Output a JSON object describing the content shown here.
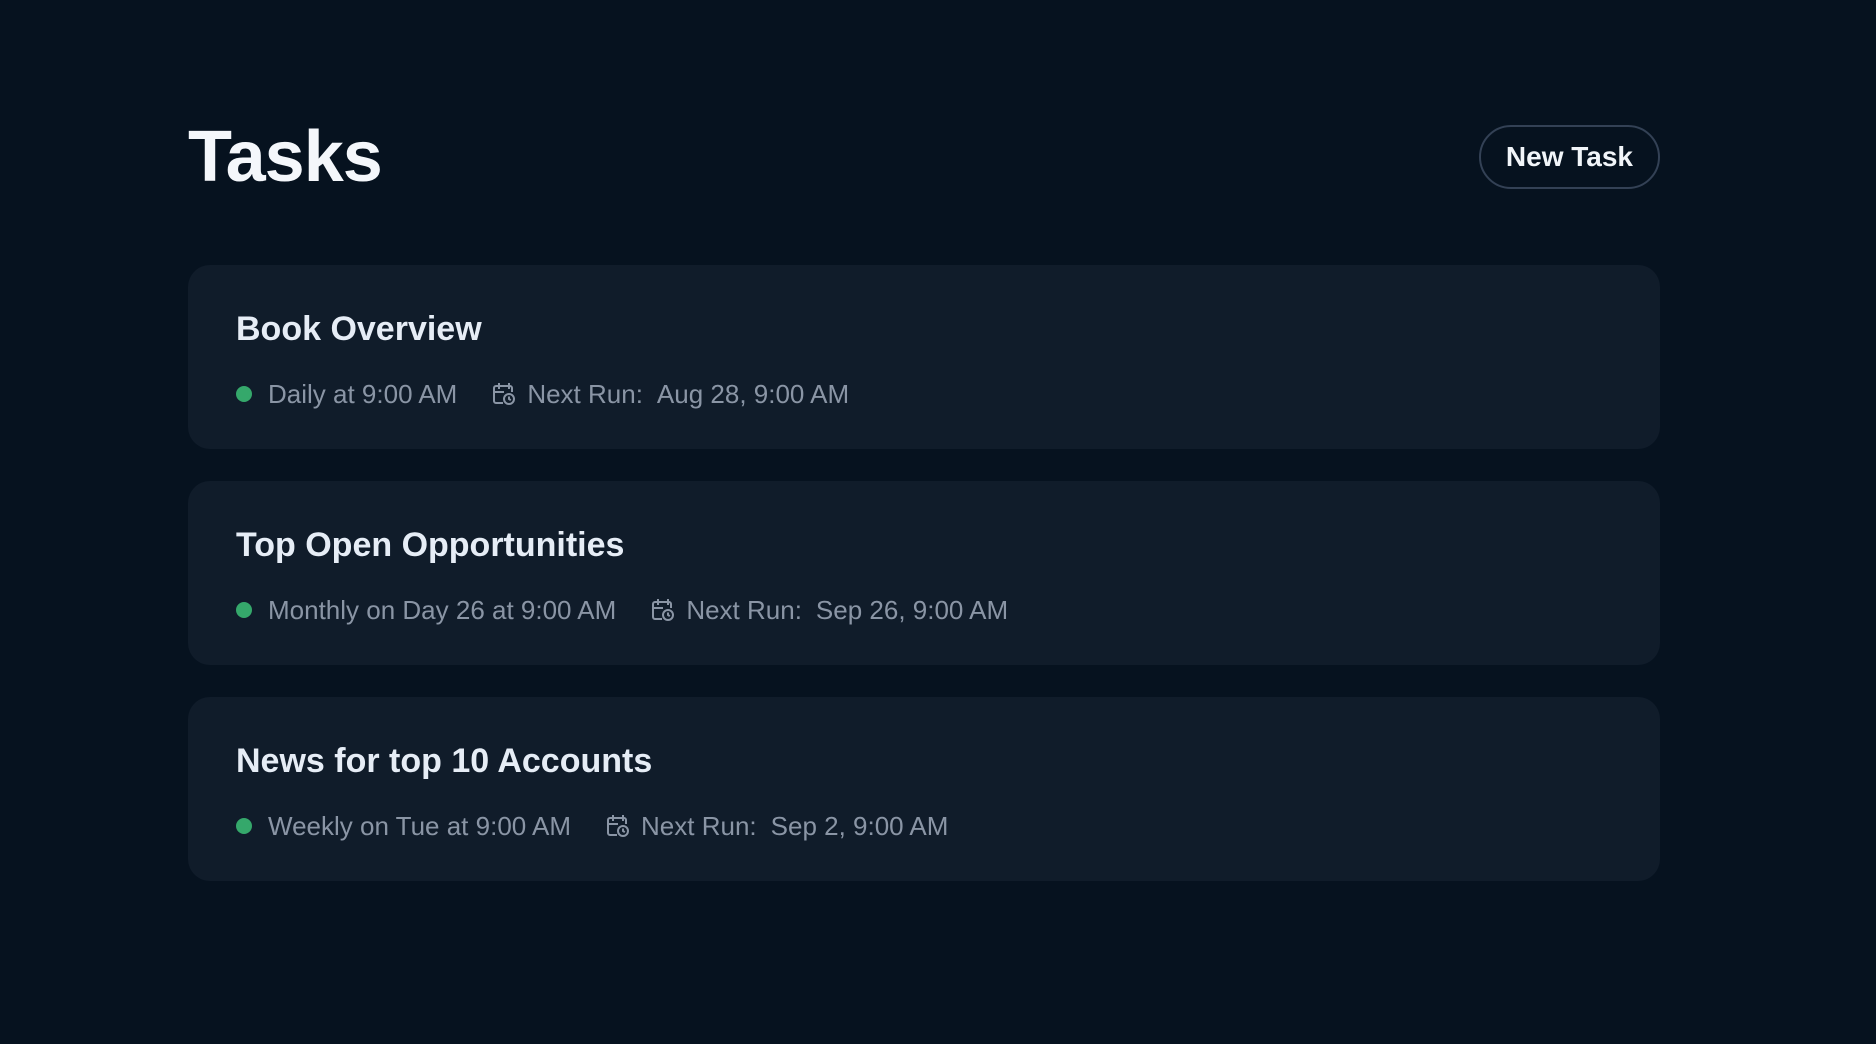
{
  "header": {
    "title": "Tasks",
    "new_task_label": "New Task"
  },
  "colors": {
    "background": "#06121f",
    "card": "#101c2a",
    "status_active": "#35a86b",
    "muted_text": "#8a95a5"
  },
  "icons": {
    "status": "status-dot",
    "schedule": "calendar-clock-icon"
  },
  "tasks": [
    {
      "title": "Book Overview",
      "schedule": "Daily at 9:00 AM",
      "next_run_label": "Next Run:",
      "next_run_value": "Aug 28, 9:00 AM"
    },
    {
      "title": "Top Open Opportunities",
      "schedule": "Monthly on Day 26 at 9:00 AM",
      "next_run_label": "Next Run:",
      "next_run_value": "Sep 26, 9:00 AM"
    },
    {
      "title": "News for top 10 Accounts",
      "schedule": "Weekly on Tue at 9:00 AM",
      "next_run_label": "Next Run:",
      "next_run_value": "Sep 2, 9:00 AM"
    }
  ]
}
